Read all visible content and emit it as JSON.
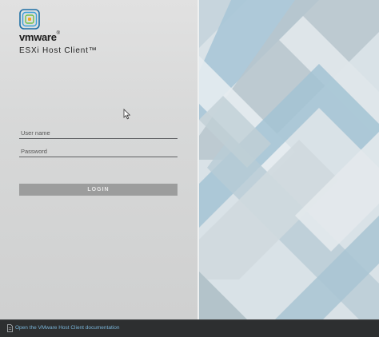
{
  "brand": {
    "name": "vmware",
    "trademark": "®",
    "product": "ESXi Host Client™",
    "logo_icon": "vmware-app-icon"
  },
  "login": {
    "username_placeholder": "User name",
    "password_placeholder": "Password",
    "login_label": "LOGIN"
  },
  "footer": {
    "doc_link": "Open the VMware Host Client documentation",
    "doc_icon": "document-icon"
  },
  "colors": {
    "footer_bg": "#2d2f30",
    "link": "#79b4d8",
    "login_button": "#9c9d9d",
    "pattern_light": "#dde5ea",
    "pattern_blue": "#a7c6d6",
    "pattern_grey": "#b9c4c8"
  }
}
